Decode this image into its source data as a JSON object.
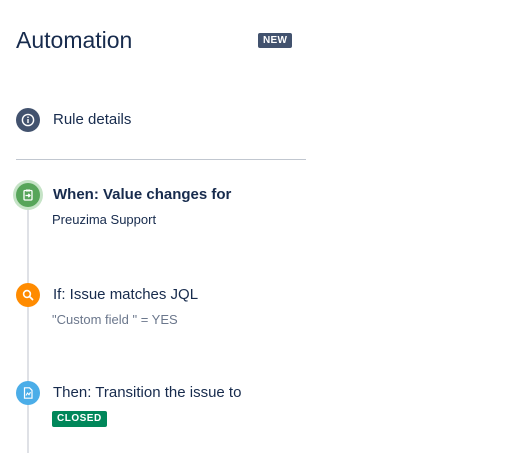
{
  "header": {
    "title": "Automation",
    "new_badge": "NEW"
  },
  "rule_details": {
    "label": "Rule details",
    "icon": "info-icon",
    "color": "#42526e"
  },
  "steps": [
    {
      "type": "trigger",
      "label": "When: Value changes for",
      "detail": "Preuzima Support",
      "icon": "trigger-icon",
      "color": "#57a55a"
    },
    {
      "type": "condition",
      "label": "If: Issue matches JQL",
      "detail": "\"Custom field \" = YES",
      "icon": "search-icon",
      "color": "#ff8b00"
    },
    {
      "type": "action",
      "label": "Then: Transition the issue to",
      "badge": "CLOSED",
      "icon": "transition-icon",
      "color": "#4bade8",
      "badge_color": "#00875a"
    }
  ]
}
